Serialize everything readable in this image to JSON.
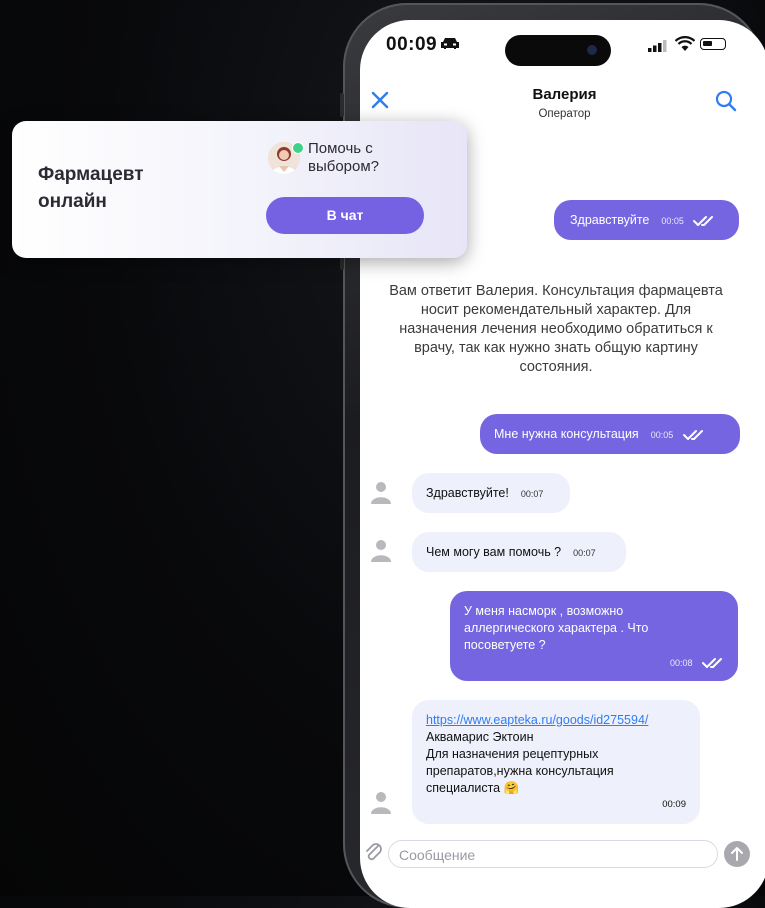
{
  "status_bar": {
    "time": "00:09"
  },
  "chat_header": {
    "operator_name": "Валерия",
    "operator_role": "Оператор"
  },
  "messages": [
    {
      "dir": "out",
      "text": "Здравствуйте",
      "time": "00:05"
    },
    {
      "dir": "system",
      "text": "Вам ответит Валерия. Консультация фармацевта носит рекомендательный характер. Для назначения лечения необходимо обратиться к врачу, так как нужно знать общую картину состояния."
    },
    {
      "dir": "out",
      "text": "Мне нужна консультация",
      "time": "00:05"
    },
    {
      "dir": "in",
      "text": "Здравствуйте!",
      "time": "00:07"
    },
    {
      "dir": "in",
      "text": "Чем могу вам помочь ?",
      "time": "00:07"
    },
    {
      "dir": "out",
      "text": "У меня насморк , возможно аллергического характера . Что посоветуете ?",
      "time": "00:08"
    },
    {
      "dir": "in",
      "link": "https://www.eapteka.ru/goods/id275594/",
      "line1": "Аквамарис Эктоин",
      "line2": "Для назначения рецептурных препаратов,нужна консультация специалиста",
      "emoji": "🤗",
      "time": "00:09"
    }
  ],
  "composer": {
    "placeholder": "Сообщение"
  },
  "widget": {
    "title": "Фармацевт онлайн",
    "help_text": "Помочь с выбором?",
    "button_label": "В чат"
  },
  "colors": {
    "accent": "#7665e0",
    "incoming_bubble": "#eef0fb",
    "online": "#3fd18a"
  },
  "icons": [
    "car-icon",
    "signal-icon",
    "wifi-icon",
    "battery-icon",
    "close-icon",
    "search-icon",
    "double-check-icon",
    "user-placeholder-icon",
    "paperclip-icon",
    "send-arrow-icon"
  ]
}
